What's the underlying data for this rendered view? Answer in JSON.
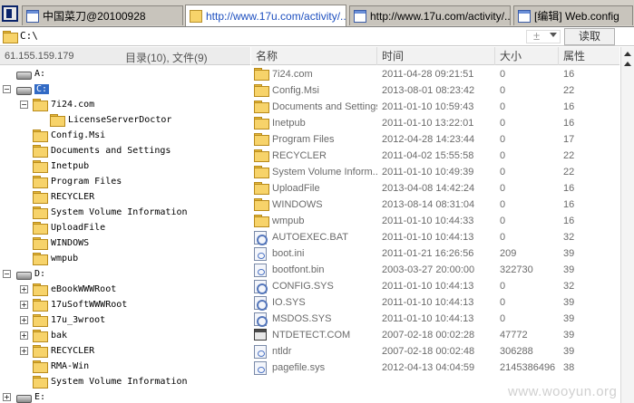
{
  "tabs": [
    {
      "label": "中国菜刀@20100928",
      "active": false,
      "icon": "window-icon"
    },
    {
      "label": "http://www.17u.com/activity/...",
      "active": true,
      "icon": "folder-icon"
    },
    {
      "label": "http://www.17u.com/activity/...",
      "active": false,
      "icon": "window-icon"
    },
    {
      "label": "[编辑] Web.config",
      "active": false,
      "icon": "document-icon"
    }
  ],
  "address": {
    "path": "C:\\",
    "plus": "±",
    "read_button": "读取"
  },
  "left_header": {
    "ip": "61.155.159.179",
    "counts": "目录(10), 文件(9)"
  },
  "tree": [
    {
      "label": "A:",
      "type": "drive",
      "toggle": ""
    },
    {
      "label": "C:",
      "type": "drive",
      "toggle": "−",
      "selected": true
    },
    {
      "label": "7i24.com",
      "type": "folder",
      "toggle": "−"
    },
    {
      "label": "LicenseServerDoctor",
      "type": "folder",
      "toggle": ""
    },
    {
      "label": "Config.Msi",
      "type": "folder",
      "toggle": ""
    },
    {
      "label": "Documents and Settings",
      "type": "folder",
      "toggle": ""
    },
    {
      "label": "Inetpub",
      "type": "folder",
      "toggle": ""
    },
    {
      "label": "Program Files",
      "type": "folder",
      "toggle": ""
    },
    {
      "label": "RECYCLER",
      "type": "folder",
      "toggle": ""
    },
    {
      "label": "System Volume Information",
      "type": "folder",
      "toggle": ""
    },
    {
      "label": "UploadFile",
      "type": "folder",
      "toggle": ""
    },
    {
      "label": "WINDOWS",
      "type": "folder",
      "toggle": ""
    },
    {
      "label": "wmpub",
      "type": "folder",
      "toggle": ""
    },
    {
      "label": "D:",
      "type": "drive",
      "toggle": "−"
    },
    {
      "label": "eBookWWWRoot",
      "type": "folder",
      "toggle": "+"
    },
    {
      "label": "17uSoftWWWRoot",
      "type": "folder",
      "toggle": "+"
    },
    {
      "label": "17u_3wroot",
      "type": "folder",
      "toggle": "+"
    },
    {
      "label": "bak",
      "type": "folder",
      "toggle": "+"
    },
    {
      "label": "RECYCLER",
      "type": "folder",
      "toggle": "+"
    },
    {
      "label": "RMA-Win",
      "type": "folder",
      "toggle": ""
    },
    {
      "label": "System Volume Information",
      "type": "folder",
      "toggle": ""
    },
    {
      "label": "E:",
      "type": "drive",
      "toggle": "+"
    }
  ],
  "columns": [
    "名称",
    "时间",
    "大小",
    "属性"
  ],
  "files": [
    {
      "name": "7i24.com",
      "time": "2011-04-28 09:21:51",
      "size": "0",
      "attr": "16",
      "icon": "folder"
    },
    {
      "name": "Config.Msi",
      "time": "2013-08-01 08:23:42",
      "size": "0",
      "attr": "22",
      "icon": "folder"
    },
    {
      "name": "Documents and Settings",
      "time": "2011-01-10 10:59:43",
      "size": "0",
      "attr": "16",
      "icon": "folder"
    },
    {
      "name": "Inetpub",
      "time": "2011-01-10 13:22:01",
      "size": "0",
      "attr": "16",
      "icon": "folder"
    },
    {
      "name": "Program Files",
      "time": "2012-04-28 14:23:44",
      "size": "0",
      "attr": "17",
      "icon": "folder"
    },
    {
      "name": "RECYCLER",
      "time": "2011-04-02 15:55:58",
      "size": "0",
      "attr": "22",
      "icon": "folder"
    },
    {
      "name": "System Volume Inform...",
      "time": "2011-01-10 10:49:39",
      "size": "0",
      "attr": "22",
      "icon": "folder"
    },
    {
      "name": "UploadFile",
      "time": "2013-04-08 14:42:24",
      "size": "0",
      "attr": "16",
      "icon": "folder"
    },
    {
      "name": "WINDOWS",
      "time": "2013-08-14 08:31:04",
      "size": "0",
      "attr": "16",
      "icon": "folder"
    },
    {
      "name": "wmpub",
      "time": "2011-01-10 10:44:33",
      "size": "0",
      "attr": "16",
      "icon": "folder"
    },
    {
      "name": "AUTOEXEC.BAT",
      "time": "2011-01-10 10:44:13",
      "size": "0",
      "attr": "32",
      "icon": "sys"
    },
    {
      "name": "boot.ini",
      "time": "2011-01-21 16:26:56",
      "size": "209",
      "attr": "39",
      "icon": "file"
    },
    {
      "name": "bootfont.bin",
      "time": "2003-03-27 20:00:00",
      "size": "322730",
      "attr": "39",
      "icon": "file"
    },
    {
      "name": "CONFIG.SYS",
      "time": "2011-01-10 10:44:13",
      "size": "0",
      "attr": "32",
      "icon": "sys"
    },
    {
      "name": "IO.SYS",
      "time": "2011-01-10 10:44:13",
      "size": "0",
      "attr": "39",
      "icon": "sys"
    },
    {
      "name": "MSDOS.SYS",
      "time": "2011-01-10 10:44:13",
      "size": "0",
      "attr": "39",
      "icon": "sys"
    },
    {
      "name": "NTDETECT.COM",
      "time": "2007-02-18 00:02:28",
      "size": "47772",
      "attr": "39",
      "icon": "com"
    },
    {
      "name": "ntldr",
      "time": "2007-02-18 00:02:48",
      "size": "306288",
      "attr": "39",
      "icon": "file"
    },
    {
      "name": "pagefile.sys",
      "time": "2012-04-13 04:04:59",
      "size": "2145386496",
      "attr": "38",
      "icon": "file"
    }
  ],
  "watermark": "www.wooyun.org"
}
